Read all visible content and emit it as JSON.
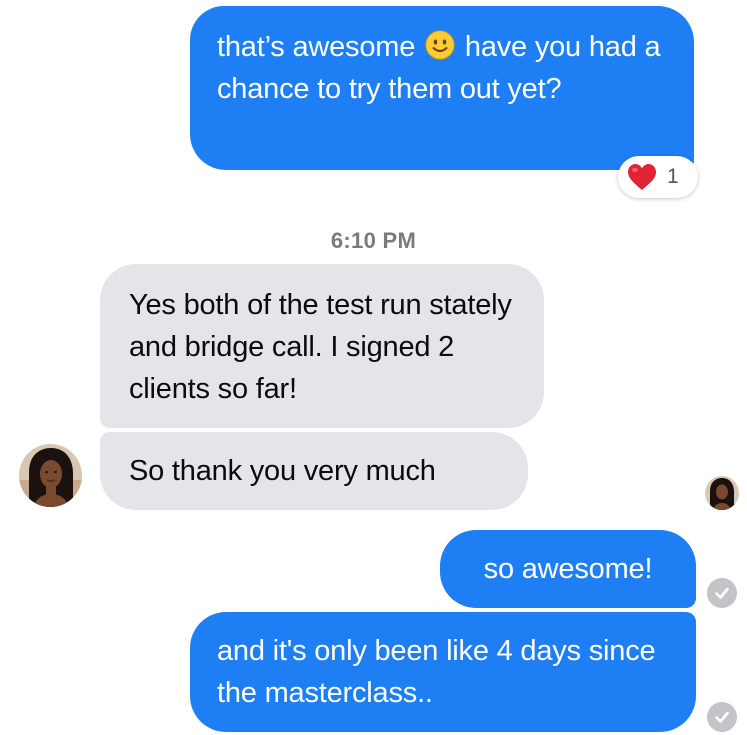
{
  "messages": [
    {
      "direction": "outgoing",
      "text_before_emoji": "that’s awesome",
      "emoji": "slightly-smiling-face",
      "text_after_emoji": " have you had a chance to try them out yet?"
    },
    {
      "direction": "incoming",
      "text": "Yes both of the test run stately and bridge call. I signed 2 clients so far!"
    },
    {
      "direction": "incoming",
      "text": "So thank you very much"
    },
    {
      "direction": "outgoing",
      "text": "so awesome!"
    },
    {
      "direction": "outgoing",
      "text": "and it's only been like 4 days since the masterclass.."
    }
  ],
  "reaction": {
    "icon": "heart-icon",
    "count": "1"
  },
  "timestamp": "6:10 PM",
  "colors": {
    "outgoing_bubble": "#1e7ef3",
    "incoming_bubble": "#e4e5e9",
    "heart": "#e02434",
    "check": "#c3c4c8"
  }
}
